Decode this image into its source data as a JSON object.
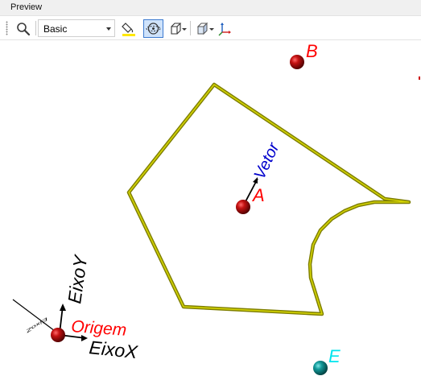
{
  "header": {
    "title": "Preview"
  },
  "toolbar": {
    "zoom_icon": "magnifier-icon",
    "style_select": {
      "value": "Basic"
    },
    "fill_icon": "paint-bucket-icon",
    "rotate_icon": "orbit-rotate-icon",
    "box_icon": "wireframe-box-icon",
    "view_icon": "view-cube-icon",
    "axes_icon": "axes-triad-icon"
  },
  "scene": {
    "points": [
      {
        "label": "A",
        "color": "#ff0000"
      },
      {
        "label": "B",
        "color": "#ff0000"
      },
      {
        "label": "E",
        "color": "#00e5ee"
      },
      {
        "label": "Origem",
        "color": "#ff0000"
      }
    ],
    "vector_label": {
      "text": "Vetor",
      "color": "#0000cc"
    },
    "axes": {
      "x_label": "EixoX",
      "y_label": "EixoY",
      "z_label": "EixoZ"
    },
    "colors": {
      "polygon": "#8f8f00",
      "polygon_highlight": "#d8d800",
      "sphere_red": "#8b0000",
      "sphere_cyan": "#008080"
    }
  }
}
